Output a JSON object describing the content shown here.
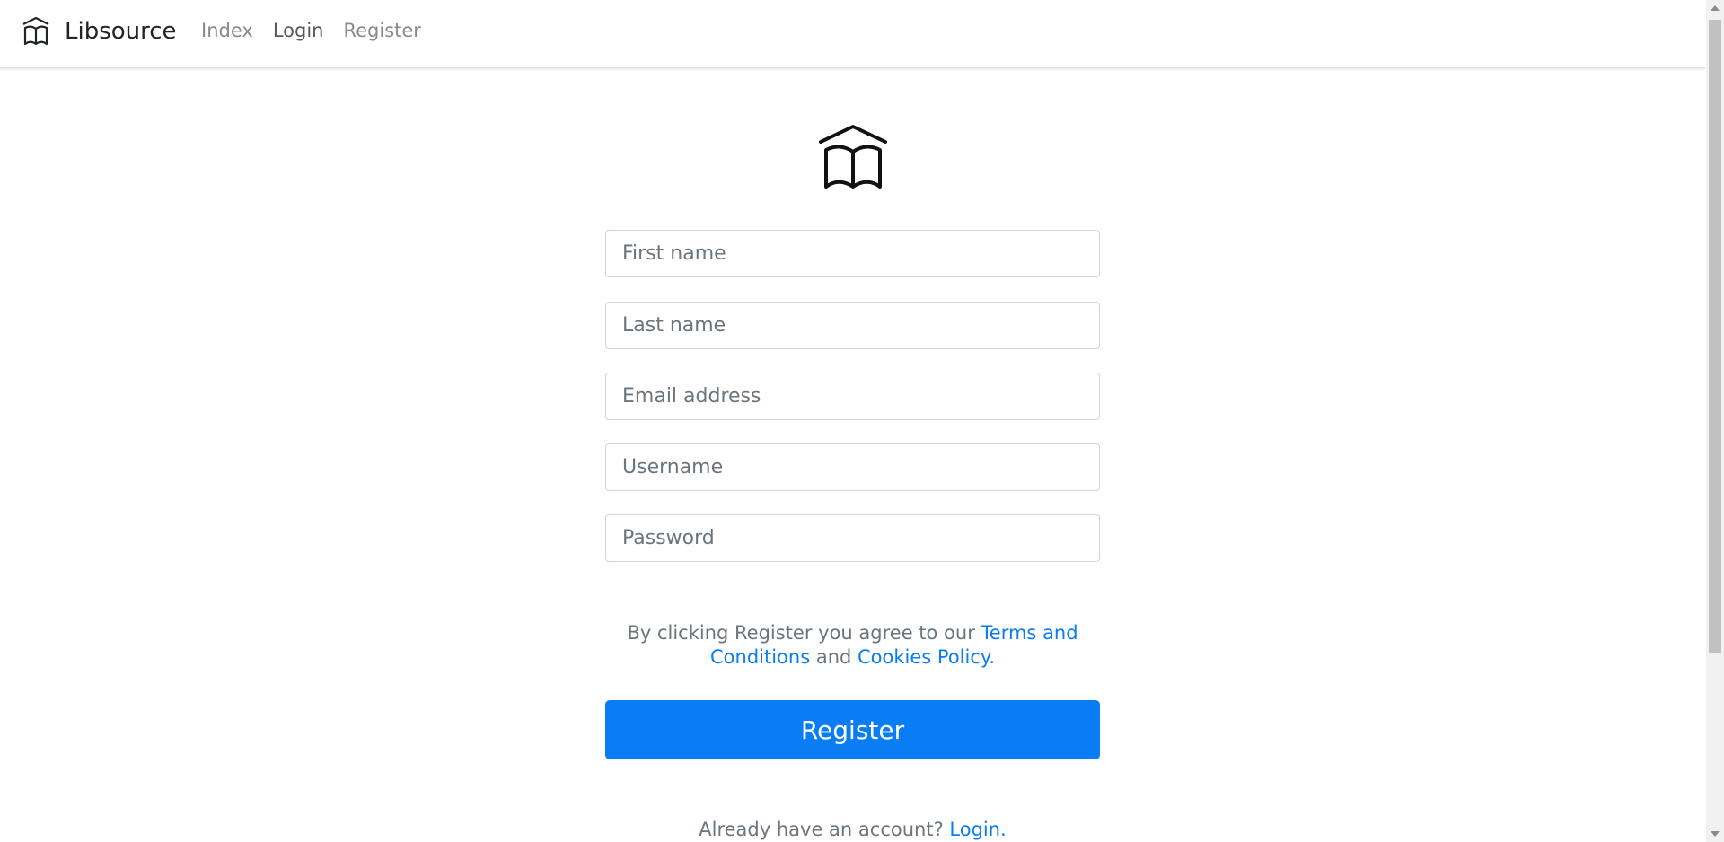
{
  "navbar": {
    "brand_name": "Libsource",
    "brand_icon": "open-book-house-icon",
    "links": [
      {
        "label": "Index"
      },
      {
        "label": "Login"
      },
      {
        "label": "Register"
      }
    ]
  },
  "form": {
    "logo_icon": "open-book-house-icon",
    "fields": {
      "first_name": {
        "placeholder": "First name",
        "value": ""
      },
      "last_name": {
        "placeholder": "Last name",
        "value": ""
      },
      "email": {
        "placeholder": "Email address",
        "value": ""
      },
      "username": {
        "placeholder": "Username",
        "value": ""
      },
      "password": {
        "placeholder": "Password",
        "value": ""
      }
    },
    "terms": {
      "prefix": "By clicking Register you agree to our ",
      "terms_link": "Terms and Conditions",
      "middle": " and ",
      "cookies_link": "Cookies Policy.",
      "suffix": ""
    },
    "register_button": "Register",
    "login_prompt": {
      "text": "Already have an account? ",
      "link": "Login."
    }
  },
  "colors": {
    "accent": "#0a7cf4",
    "muted_text": "#6c757d",
    "border": "#ced4da"
  }
}
